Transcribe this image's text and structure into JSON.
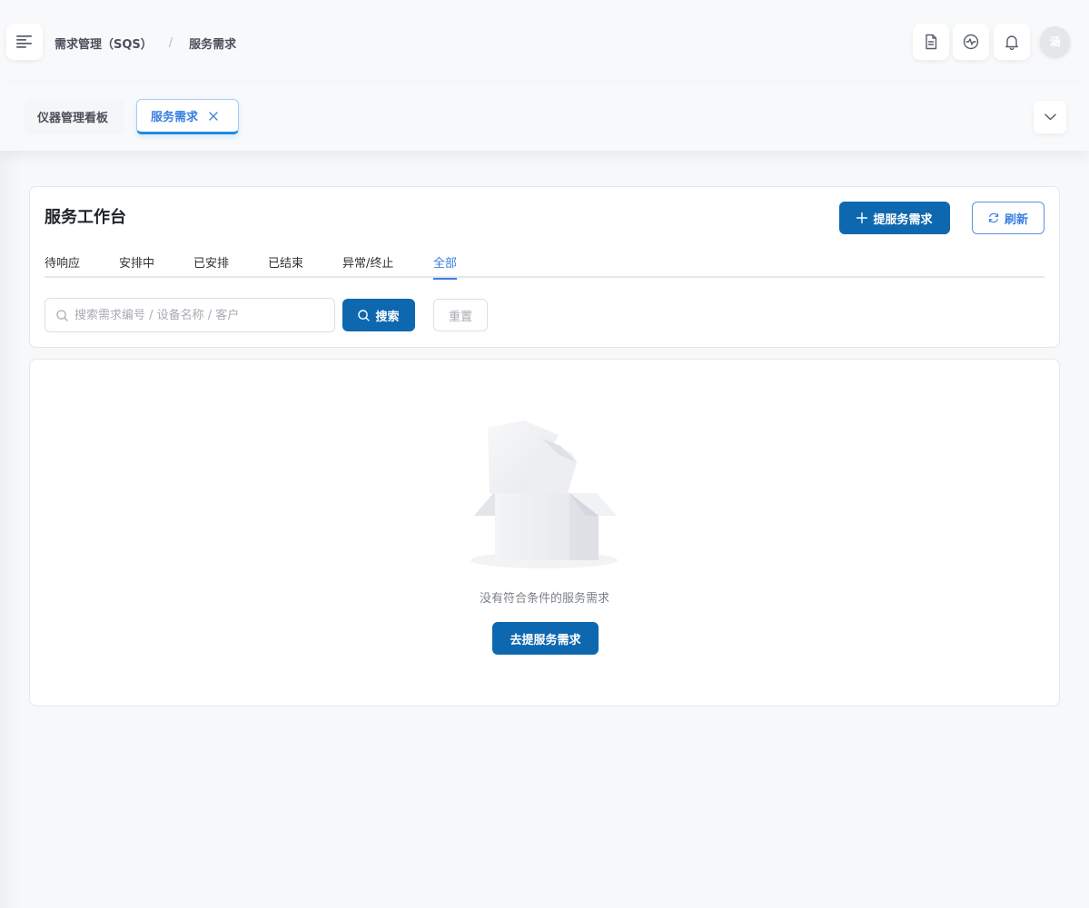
{
  "header": {
    "breadcrumb": [
      "需求管理（SQS）",
      "/",
      "服务需求"
    ],
    "menu_icon": "menu-icon",
    "actions": [
      {
        "icon": "document-icon"
      },
      {
        "icon": "activity-icon"
      },
      {
        "icon": "bell-icon"
      }
    ],
    "avatar_text": "涵"
  },
  "page_tabs": [
    {
      "label": "仪器管理看板",
      "active": false
    },
    {
      "label": "服务需求",
      "active": true,
      "closable": true
    }
  ],
  "workbench": {
    "title": "服务工作台",
    "submit_button": "提服务需求",
    "refresh_button": "刷新",
    "status_tabs": [
      {
        "label": "待响应",
        "active": false
      },
      {
        "label": "安排中",
        "active": false
      },
      {
        "label": "已安排",
        "active": false
      },
      {
        "label": "已结束",
        "active": false
      },
      {
        "label": "异常/终止",
        "active": false
      },
      {
        "label": "全部",
        "active": true
      }
    ],
    "search": {
      "placeholder": "搜索需求编号 / 设备名称 / 客户",
      "value": "",
      "search_button": "搜索",
      "reset_button": "重置"
    }
  },
  "empty_state": {
    "message": "没有符合条件的服务需求",
    "action_button": "去提服务需求"
  },
  "colors": {
    "primary": "#0e68b0",
    "accent_blue": "#3a7fe0",
    "background": "#f7f8fa"
  }
}
